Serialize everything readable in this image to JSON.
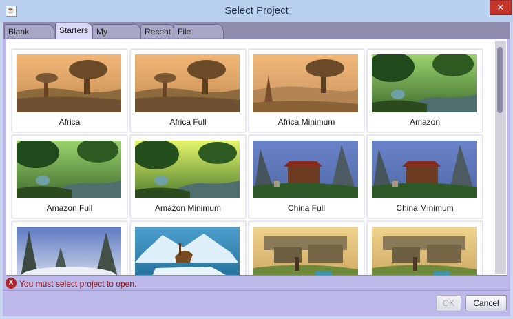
{
  "window": {
    "title": "Select Project",
    "close_glyph": "✕"
  },
  "tabs": [
    {
      "label": "Blank Slates",
      "selected": false
    },
    {
      "label": "Starters",
      "selected": true
    },
    {
      "label": "My Projects",
      "selected": false
    },
    {
      "label": "Recent",
      "selected": false
    },
    {
      "label": "File System",
      "selected": false
    }
  ],
  "projects": [
    {
      "label": "Africa",
      "theme": "africa"
    },
    {
      "label": "Africa Full",
      "theme": "africa"
    },
    {
      "label": "Africa Minimum",
      "theme": "africa-min"
    },
    {
      "label": "Amazon",
      "theme": "amazon"
    },
    {
      "label": "Amazon Full",
      "theme": "amazon"
    },
    {
      "label": "Amazon Minimum",
      "theme": "amazon-min"
    },
    {
      "label": "China Full",
      "theme": "china"
    },
    {
      "label": "China Minimum",
      "theme": "china"
    },
    {
      "label": "",
      "theme": "mountains"
    },
    {
      "label": "",
      "theme": "glacier"
    },
    {
      "label": "",
      "theme": "desert"
    },
    {
      "label": "",
      "theme": "desert"
    }
  ],
  "status": {
    "error_glyph": "X",
    "message": "You must select project to open."
  },
  "buttons": {
    "ok": "OK",
    "cancel": "Cancel"
  },
  "colors": {
    "tab_selected": "#dcd9f7",
    "error": "#b2262a",
    "close": "#c5352c"
  }
}
